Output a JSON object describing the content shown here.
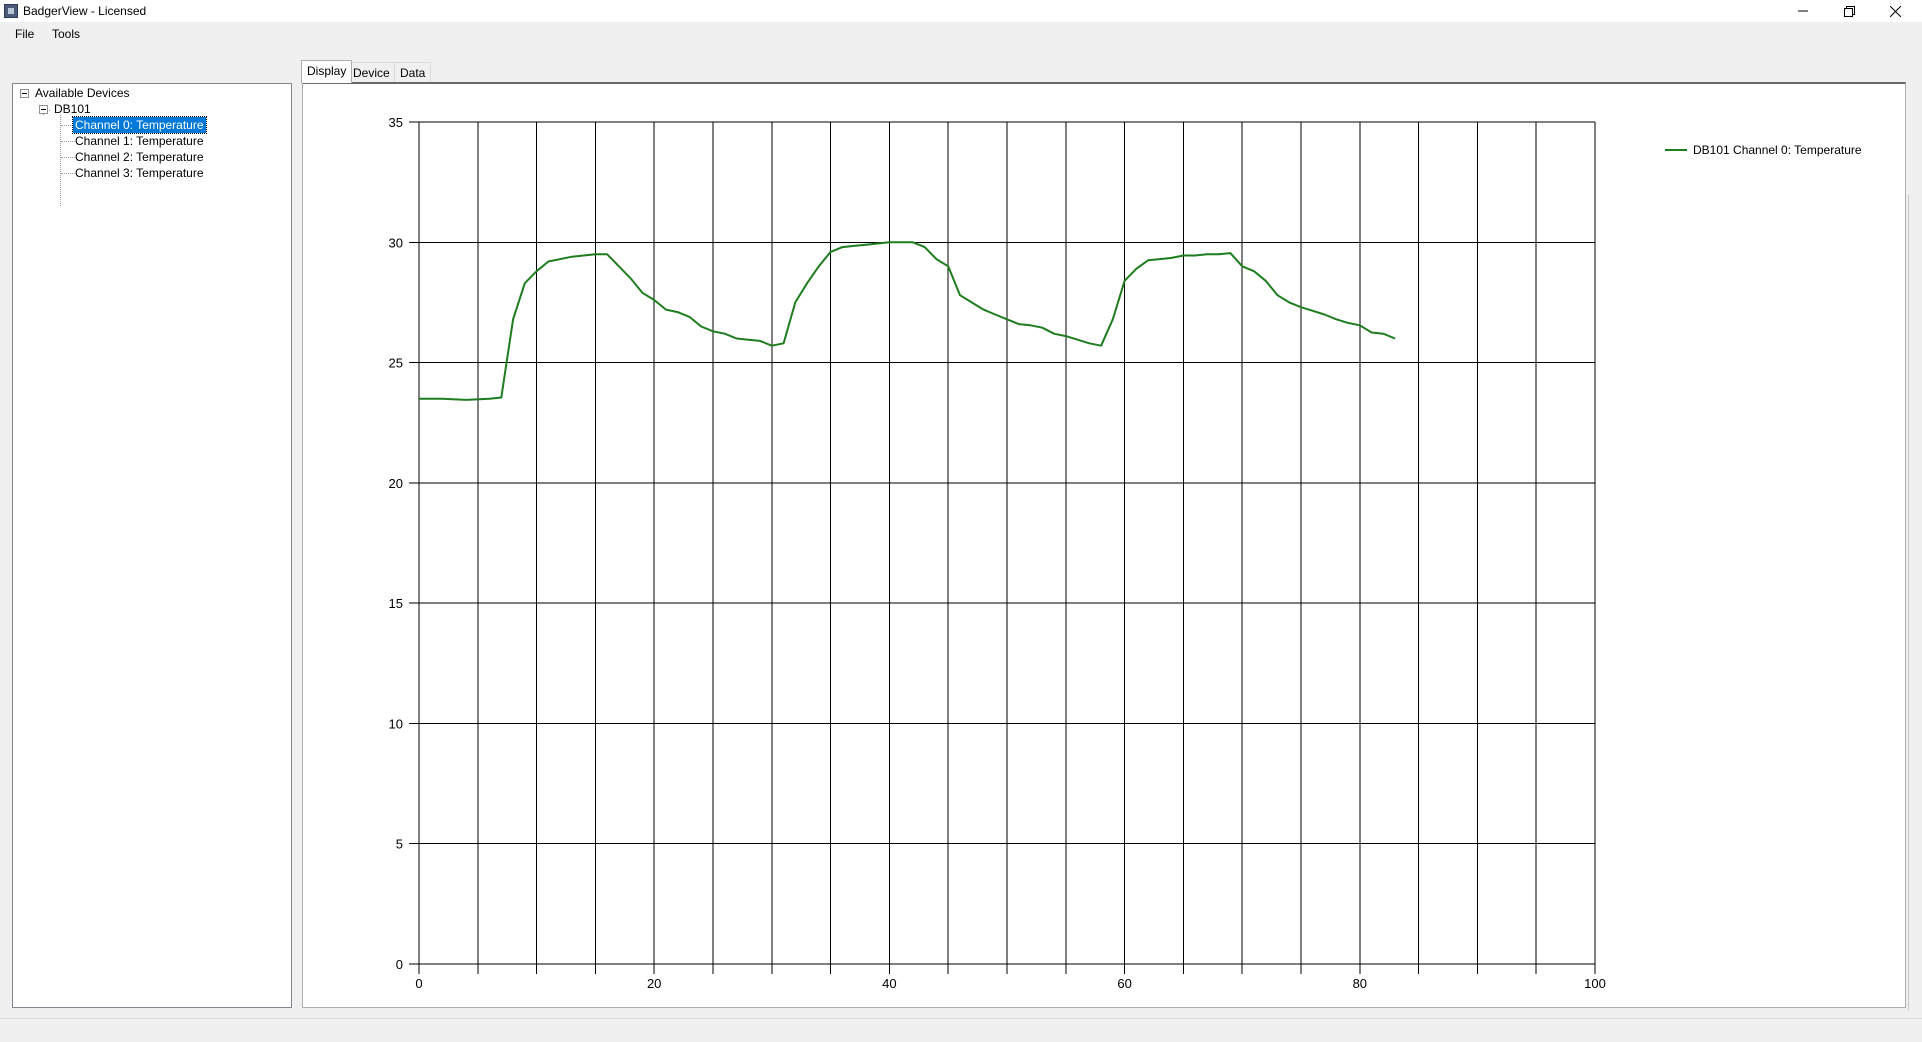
{
  "window": {
    "title": "BadgerView - Licensed",
    "controls": [
      "minimize-icon",
      "restore-icon",
      "close-icon"
    ]
  },
  "menu": {
    "items": [
      "File",
      "Tools"
    ]
  },
  "tree": {
    "root": "Available Devices",
    "device": "DB101",
    "channels": [
      "Channel 0: Temperature",
      "Channel 1: Temperature",
      "Channel 2: Temperature",
      "Channel 3: Temperature"
    ],
    "selected_index": 0
  },
  "tabs": [
    "Display",
    "Device",
    "Data"
  ],
  "active_tab": "Display",
  "colors": {
    "series": "#1e7d1e",
    "selection": "#0078d7",
    "grid": "#000000"
  },
  "chart_data": {
    "type": "line",
    "title": "",
    "xlabel": "",
    "ylabel": "",
    "xlim": [
      0,
      100
    ],
    "ylim": [
      0,
      35
    ],
    "x_ticks": [
      0,
      20,
      40,
      60,
      80,
      100
    ],
    "y_ticks": [
      0,
      5,
      10,
      15,
      20,
      25,
      30,
      35
    ],
    "grid": true,
    "legend": "top-right",
    "series": [
      {
        "name": "DB101 Channel 0: Temperature",
        "color": "#1e7d1e",
        "x": [
          0,
          2,
          4,
          6,
          7,
          8,
          9,
          10,
          11,
          13,
          15,
          16,
          17,
          18,
          19,
          20,
          21,
          22,
          23,
          24,
          25,
          26,
          27,
          28,
          29,
          30,
          31,
          32,
          33,
          34,
          35,
          36,
          37,
          38,
          39,
          40,
          41,
          42,
          43,
          44,
          45,
          46,
          47,
          48,
          49,
          50,
          51,
          52,
          53,
          54,
          55,
          56,
          57,
          58,
          59,
          60,
          61,
          62,
          63,
          64,
          65,
          66,
          67,
          68,
          69,
          70,
          71,
          72,
          73,
          74,
          75,
          76,
          77,
          78,
          79,
          80,
          81,
          82,
          83
        ],
        "y": [
          23.5,
          23.5,
          23.45,
          23.5,
          23.55,
          26.8,
          28.3,
          28.8,
          29.2,
          29.4,
          29.5,
          29.5,
          29.0,
          28.5,
          27.9,
          27.6,
          27.2,
          27.1,
          26.9,
          26.5,
          26.3,
          26.2,
          26.0,
          25.95,
          25.9,
          25.7,
          25.8,
          27.5,
          28.3,
          29.0,
          29.6,
          29.8,
          29.85,
          29.9,
          29.95,
          30.0,
          30.0,
          30.0,
          29.8,
          29.3,
          29.0,
          27.8,
          27.5,
          27.2,
          27.0,
          26.8,
          26.6,
          26.55,
          26.45,
          26.2,
          26.1,
          25.95,
          25.8,
          25.7,
          26.8,
          28.4,
          28.9,
          29.25,
          29.3,
          29.35,
          29.45,
          29.45,
          29.5,
          29.5,
          29.55,
          29.0,
          28.8,
          28.4,
          27.8,
          27.5,
          27.3,
          27.15,
          27.0,
          26.8,
          26.65,
          26.55,
          26.25,
          26.2,
          26.0
        ]
      }
    ]
  }
}
